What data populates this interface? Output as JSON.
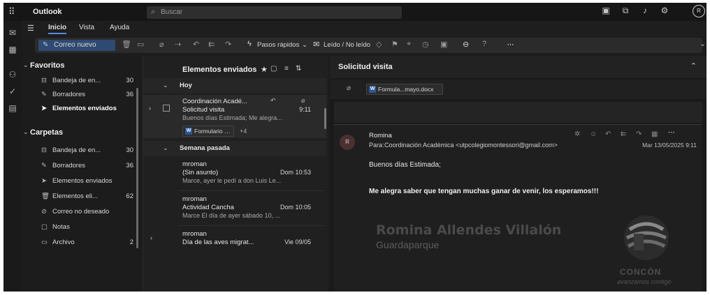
{
  "app": {
    "name": "Outlook",
    "avatar_initial": "R"
  },
  "search": {
    "placeholder": "Buscar"
  },
  "menu": {
    "tabs": [
      "Inicio",
      "Vista",
      "Ayuda"
    ]
  },
  "ribbon": {
    "new_mail": "Correo nuevo",
    "quick_steps": "Pasos rápidos",
    "read_unread": "Leído / No leído",
    "more": "···"
  },
  "folders": {
    "favorites_label": "Favoritos",
    "favorites": [
      {
        "label": "Bandeja de en...",
        "count": "30",
        "icon": "inbox-icon"
      },
      {
        "label": "Borradores",
        "count": "36",
        "icon": "pencil-icon"
      },
      {
        "label": "Elementos enviados",
        "count": "",
        "icon": "send-icon"
      }
    ],
    "folders_label": "Carpetas",
    "items": [
      {
        "label": "Bandeja de en...",
        "count": "30",
        "icon": "inbox-icon"
      },
      {
        "label": "Borradores",
        "count": "36",
        "icon": "pencil-icon"
      },
      {
        "label": "Elementos enviados",
        "count": "",
        "icon": "send-icon"
      },
      {
        "label": "Elementos eli...",
        "count": "62",
        "icon": "trash-icon"
      },
      {
        "label": "Correo no deseado",
        "count": "",
        "icon": "junk-icon"
      },
      {
        "label": "Notas",
        "count": "",
        "icon": "note-icon"
      },
      {
        "label": "Archivo",
        "count": "2",
        "icon": "archive-icon"
      }
    ]
  },
  "list": {
    "title": "Elementos enviados",
    "groups": [
      {
        "label": "Hoy",
        "messages": [
          {
            "from": "Coordinación Acadé...",
            "subject": "Solicitud visita",
            "time": "9:11",
            "preview": "Buenos días Estimada; Me alegra...",
            "attachment": "Formulario gua...",
            "extra": "+4"
          }
        ]
      },
      {
        "label": "Semana pasada",
        "messages": [
          {
            "from": "mroman",
            "subject": "(Sin asunto)",
            "time": "Dom 10:53",
            "preview": "Marce, ayer le pedí a don Luis Le..."
          },
          {
            "from": "mroman",
            "subject": "Actividad Cancha",
            "time": "Dom 10:05",
            "preview": "Marce El día de ayer sábado 10, ..."
          },
          {
            "from": "mroman",
            "subject": "Día de las aves migrat...",
            "time": "Vie 09/05",
            "preview": ""
          }
        ]
      }
    ]
  },
  "reading": {
    "subject": "Solicitud visita",
    "attachment": "Formula...mayo.docx",
    "sender": "Romina",
    "sender_initial": "R",
    "to_label": "Para:",
    "to": "Coordinación Académica <utpcolegiomontessori@gmail.com>",
    "date": "Mar 13/05/2025 9:11",
    "greeting": "Buenos días Estimada;",
    "body": "Me alegra saber que tengan muchas ganar de venir, los esperamos!!!",
    "signature_name": "Romina Allendes Villalón",
    "signature_role": "Guardaparque",
    "logo_text": "CONCÓN",
    "logo_tagline": "avanzamos contigo"
  }
}
